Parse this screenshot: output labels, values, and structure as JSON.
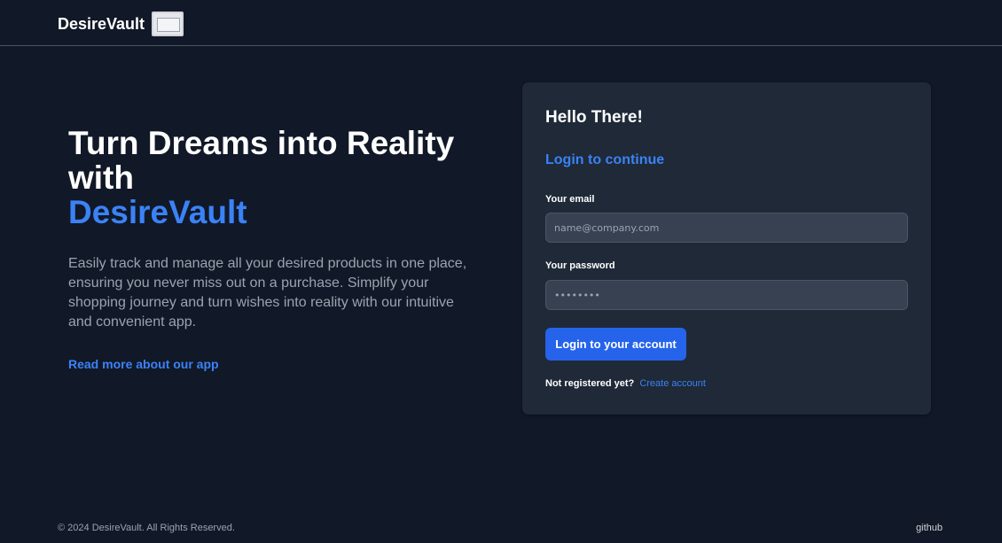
{
  "navbar": {
    "brand_name": "DesireVault"
  },
  "hero": {
    "title": "Turn Dreams into Reality with",
    "title_accent": "DesireVault",
    "description": "Easily track and manage all your desired products in one place, ensuring you never miss out on a purchase. Simplify your shopping journey and turn wishes into reality with our intuitive and convenient app.",
    "read_more_link": "Read more about our app"
  },
  "login_card": {
    "greeting": "Hello There!",
    "subtitle": "Login to continue",
    "email_label": "Your email",
    "email_placeholder": "name@company.com",
    "email_value": "",
    "password_label": "Your password",
    "password_value": "••••••••",
    "submit_label": "Login to your account",
    "register_prompt": "Not registered yet?",
    "register_link": "Create account"
  },
  "footer": {
    "copyright": "© 2024 DesireVault. All Rights Reserved.",
    "github_link": "github"
  },
  "colors": {
    "background": "#111827",
    "card": "#1f2937",
    "accent": "#3b82f6",
    "button": "#2563eb"
  }
}
